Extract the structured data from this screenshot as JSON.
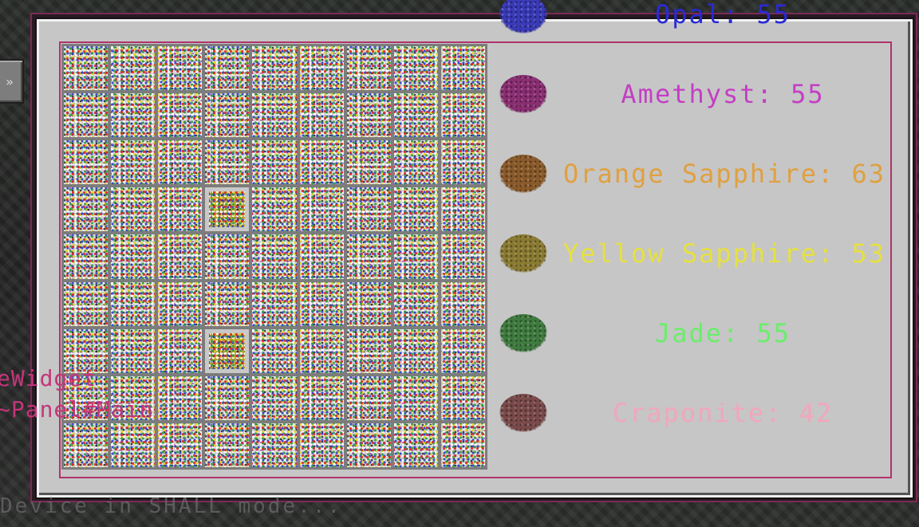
{
  "gems": [
    {
      "text": "Opal: 55",
      "color": "#2a2ad6",
      "gem_color": "#3a3ab8"
    },
    {
      "text": "Amethyst: 55",
      "color": "#c33fc4",
      "gem_color": "#8a2e72"
    },
    {
      "text": "Orange Sapphire: 63",
      "color": "#e0a040",
      "gem_color": "#8a5a2a"
    },
    {
      "text": "Yellow Sapphire: 53",
      "color": "#e6e040",
      "gem_color": "#8a7a32"
    },
    {
      "text": "Jade: 55",
      "color": "#6aee6a",
      "gem_color": "#3f7a3f"
    },
    {
      "text": "Craponite: 42",
      "color": "#f2a6bc",
      "gem_color": "#7a4a4a"
    }
  ],
  "debug_overlay": {
    "line1": "eWidget",
    "line2": "~Panel#Main"
  },
  "background_button": {
    "icon": "chevron-right-icon",
    "glyph": "»"
  },
  "bottom_text": "Device in SHALL mode...",
  "grid": {
    "rows": 9,
    "cols": 9,
    "highlighted_slots": [
      30,
      57
    ]
  },
  "colors": {
    "panel": "#c6c6c6",
    "frame": "#b0336a",
    "overlay_text": "#c4357a"
  }
}
